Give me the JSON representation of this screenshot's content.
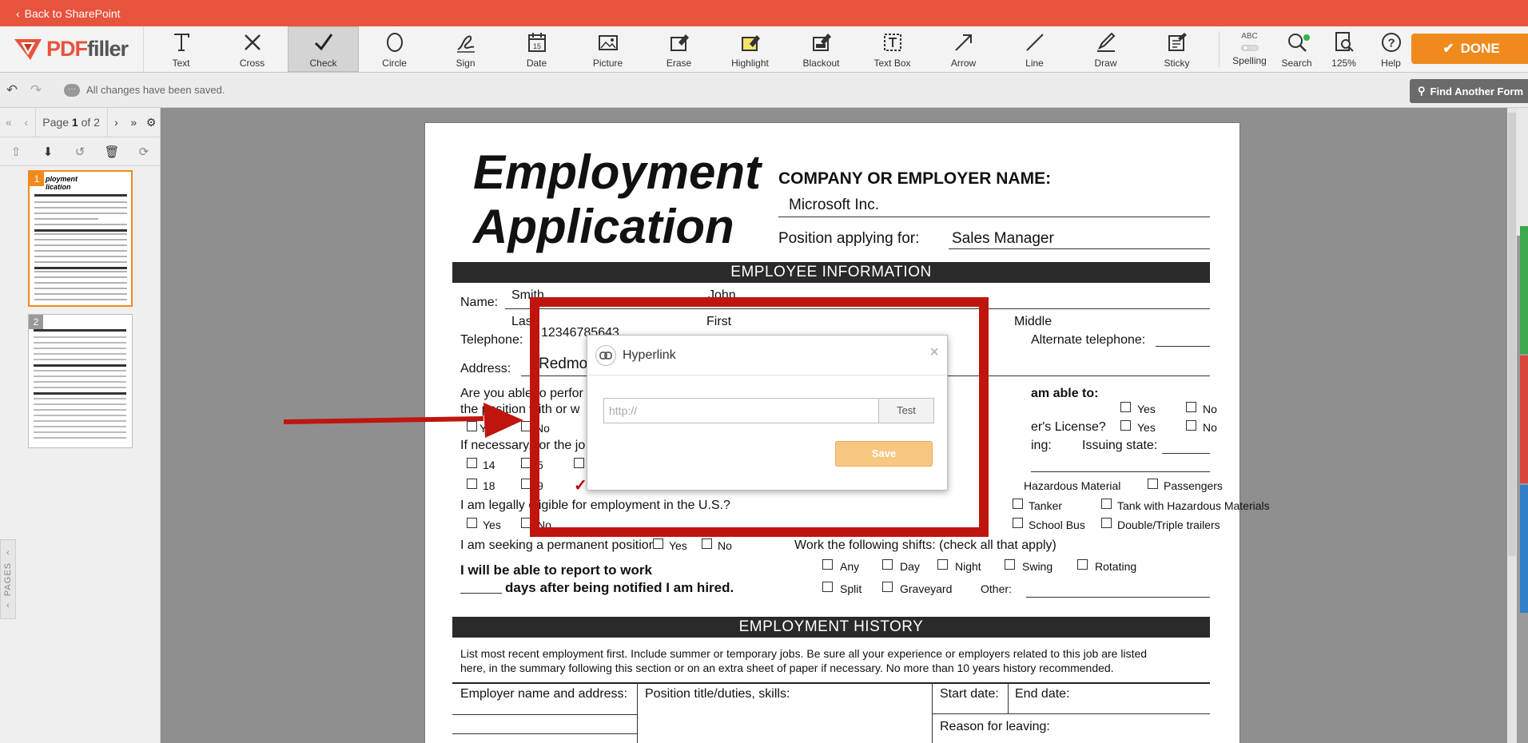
{
  "topbar": {
    "back_label": "Back to SharePoint"
  },
  "logo": {
    "brand_a": "PDF",
    "brand_b": "filler"
  },
  "tools": [
    {
      "label": "Text",
      "icon": "text-icon"
    },
    {
      "label": "Cross",
      "icon": "cross-icon"
    },
    {
      "label": "Check",
      "icon": "check-icon",
      "active": true
    },
    {
      "label": "Circle",
      "icon": "circle-icon"
    },
    {
      "label": "Sign",
      "icon": "sign-icon"
    },
    {
      "label": "Date",
      "icon": "calendar-icon"
    },
    {
      "label": "Picture",
      "icon": "picture-icon"
    },
    {
      "label": "Erase",
      "icon": "eraser-icon"
    },
    {
      "label": "Highlight",
      "icon": "highlight-icon"
    },
    {
      "label": "Blackout",
      "icon": "blackout-icon"
    },
    {
      "label": "Text Box",
      "icon": "textbox-icon"
    },
    {
      "label": "Arrow",
      "icon": "arrow-icon"
    },
    {
      "label": "Line",
      "icon": "line-icon"
    },
    {
      "label": "Draw",
      "icon": "draw-icon"
    },
    {
      "label": "Sticky",
      "icon": "sticky-icon"
    }
  ],
  "right_tools": {
    "spelling": "Spelling",
    "spelling_top": "ABC",
    "search": "Search",
    "zoom": "125%",
    "help": "Help"
  },
  "done_label": "DONE",
  "subbar": {
    "saved_text": "All changes have been saved.",
    "find_label": "Find Another Form"
  },
  "pager": {
    "page_prefix": "Page",
    "page_current": "1",
    "page_sep": "of 2"
  },
  "thumbs": [
    "1",
    "2"
  ],
  "pages_tab": "PAGES",
  "form": {
    "title_line1": "Employment",
    "title_line2": "Application",
    "company_label": "COMPANY OR EMPLOYER NAME:",
    "company_value": "Microsoft Inc.",
    "position_label": "Position applying for:",
    "position_value": "Sales Manager",
    "section_employee": "EMPLOYEE INFORMATION",
    "name_label": "Name:",
    "name_last": "Smith",
    "name_first": "John",
    "last_label": "Last",
    "first_label": "First",
    "middle_label": "Middle",
    "telephone_label": "Telephone:",
    "telephone_value": "12346785643",
    "alt_phone_label": "Alternate telephone:",
    "address_label": "Address:",
    "address_value": "Redmo",
    "able_line1": "Are you able to perfor",
    "able_line2": "the position with or w",
    "able_right": "am able to:",
    "license_label": "er's License?",
    "if_necessary": "If necessary, for the jo",
    "issuing_left": "ing:",
    "issuing_state": "Issuing state:",
    "yes": "Yes",
    "no": "No",
    "ye_frag": "Ye",
    "num_14": "14",
    "num_5": "5",
    "num_18": "18",
    "num_9": "9",
    "hazmat": "Hazardous Material",
    "passengers": "Passengers",
    "eligible": "I am legally eligible for employment in the U.S.?",
    "tanker": "Tanker",
    "tank_haz": "Tank with Hazardous Materials",
    "school_bus": "School Bus",
    "double_triple": "Double/Triple trailers",
    "permanent": "I am seeking a permanent position:",
    "shifts": "Work the following shifts: (check all that apply)",
    "report_line1": "I will be able to report to work",
    "report_line2": "days after being notified I am hired.",
    "shift_any": "Any",
    "shift_day": "Day",
    "shift_night": "Night",
    "shift_swing": "Swing",
    "shift_rotating": "Rotating",
    "shift_split": "Split",
    "shift_graveyard": "Graveyard",
    "other_label": "Other:",
    "section_history": "EMPLOYMENT HISTORY",
    "history_note1": "List most recent employment first. Include summer or temporary jobs. Be sure all your experience or employers related to this job are listed",
    "history_note2": "here, in the summary following this section or on an extra sheet of paper if necessary. No more than 10 years history recommended.",
    "employer_name": "Employer name and address:",
    "position_title": "Position title/duties, skills:",
    "start_date": "Start date:",
    "end_date": "End date:",
    "reason": "Reason for leaving:"
  },
  "dialog": {
    "title": "Hyperlink",
    "placeholder": "http://",
    "test": "Test",
    "save": "Save",
    "close": "×"
  }
}
